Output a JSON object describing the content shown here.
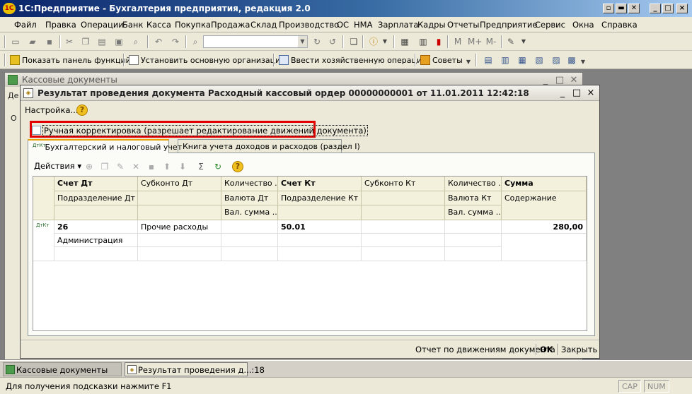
{
  "app": {
    "title": "1С:Предприятие - Бухгалтерия предприятия, редакция 2.0",
    "logo": "1С"
  },
  "window_controls": {
    "minimize": "_",
    "maximize": "□",
    "close": "×"
  },
  "menu": [
    {
      "label": "Файл"
    },
    {
      "label": "Правка"
    },
    {
      "label": "Операции"
    },
    {
      "label": "Банк"
    },
    {
      "label": "Касса"
    },
    {
      "label": "Покупка"
    },
    {
      "label": "Продажа"
    },
    {
      "label": "Склад"
    },
    {
      "label": "Производство"
    },
    {
      "label": "ОС"
    },
    {
      "label": "НМА"
    },
    {
      "label": "Зарплата"
    },
    {
      "label": "Кадры"
    },
    {
      "label": "Отчеты"
    },
    {
      "label": "Предприятие"
    },
    {
      "label": "Сервис"
    },
    {
      "label": "Окна"
    },
    {
      "label": "Справка"
    }
  ],
  "toolbar1": {
    "m_label": "М",
    "mplus_label": "М+",
    "mminus_label": "М-"
  },
  "toolbar2": {
    "show_panel": "Показать панель функций",
    "set_org": "Установить основную организацию",
    "enter_op": "Ввести хозяйственную операцию",
    "tips": "Советы"
  },
  "back_window": {
    "title": "Кассовые документы",
    "frag1": "Де",
    "frag2": "О"
  },
  "dialog": {
    "title": "Результат проведения документа Расходный кассовый ордер 00000000001 от 11.01.2011 12:42:18",
    "settings_label": "Настройка...",
    "manual_correction": "Ручная корректировка (разрешает редактирование движений документа)",
    "tabs": [
      {
        "label": "Бухгалтерский и налоговый учет"
      },
      {
        "label": "Книга учета доходов и расходов (раздел I)"
      }
    ],
    "actions_label": "Действия",
    "grid": {
      "headers_row1": [
        "Счет Дт",
        "Субконто Дт",
        "Количество ...",
        "Счет Кт",
        "Субконто Кт",
        "Количество ...",
        "Сумма"
      ],
      "headers_row2": [
        "Подразделение Дт",
        "",
        "Валюта Дт",
        "Подразделение Кт",
        "",
        "Валюта Кт",
        "Содержание"
      ],
      "headers_row3": [
        "",
        "",
        "Вал. сумма ...",
        "",
        "",
        "Вал. сумма ...",
        ""
      ],
      "rows": [
        {
          "icon": "ДтКт",
          "line1": [
            "26",
            "Прочие расходы",
            "",
            "50.01",
            "",
            "",
            "280,00"
          ],
          "line2": [
            "Администрация",
            "",
            "",
            "",
            "",
            "",
            ""
          ]
        }
      ]
    },
    "footer": {
      "report": "Отчет по движениям документа",
      "ok": "OK",
      "close": "Закрыть"
    }
  },
  "taskbar": [
    {
      "label": "Кассовые документы"
    },
    {
      "label": "Результат проведения д...:18"
    }
  ],
  "status": {
    "hint": "Для получения подсказки нажмите F1",
    "cap": "CAP",
    "num": "NUM"
  }
}
